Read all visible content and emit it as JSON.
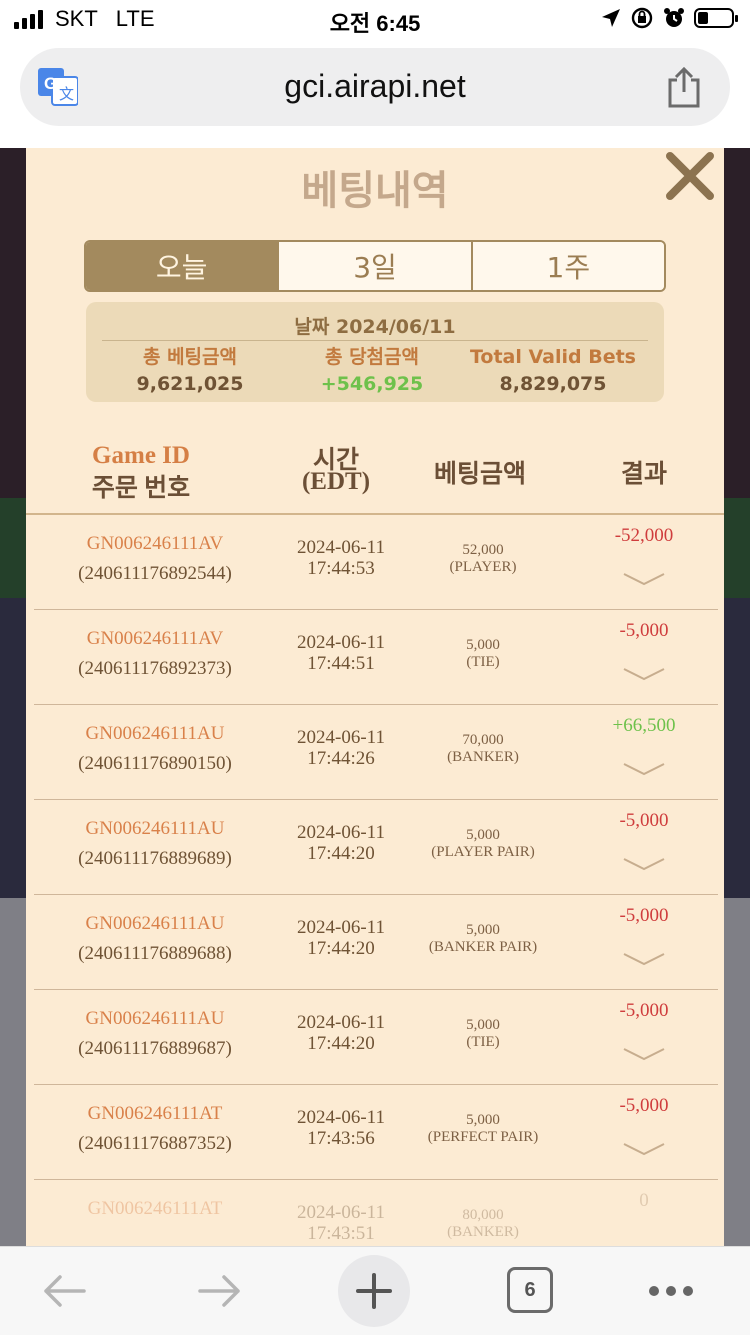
{
  "status_bar": {
    "carrier": "SKT",
    "network": "LTE",
    "time": "오전 6:45"
  },
  "browser": {
    "url": "gci.airapi.net",
    "tab_count": "6"
  },
  "modal": {
    "title": "베팅내역",
    "tabs": [
      {
        "label": "오늘",
        "active": true
      },
      {
        "label": "3일",
        "active": false
      },
      {
        "label": "1주",
        "active": false
      }
    ],
    "summary": {
      "date_label": "날짜",
      "date": "2024/06/11",
      "total_bet_label": "총 베팅금액",
      "total_bet": "9,621,025",
      "total_win_label": "총 당첨금액",
      "total_win": "+546,925",
      "valid_label": "Total Valid Bets",
      "valid": "8,829,075"
    },
    "columns": {
      "game_id": "Game ID",
      "order_no": "주문 번호",
      "time": "시간",
      "time_zone": "(EDT)",
      "amount": "베팅금액",
      "result": "결과"
    },
    "rows": [
      {
        "game_id": "GN006246111AV",
        "order": "(240611176892544)",
        "date": "2024-06-11",
        "time": "17:44:53",
        "amount": "52,000",
        "bet_type": "(PLAYER)",
        "result": "-52,000",
        "result_class": "neg"
      },
      {
        "game_id": "GN006246111AV",
        "order": "(240611176892373)",
        "date": "2024-06-11",
        "time": "17:44:51",
        "amount": "5,000",
        "bet_type": "(TIE)",
        "result": "-5,000",
        "result_class": "neg"
      },
      {
        "game_id": "GN006246111AU",
        "order": "(240611176890150)",
        "date": "2024-06-11",
        "time": "17:44:26",
        "amount": "70,000",
        "bet_type": "(BANKER)",
        "result": "+66,500",
        "result_class": "pos"
      },
      {
        "game_id": "GN006246111AU",
        "order": "(240611176889689)",
        "date": "2024-06-11",
        "time": "17:44:20",
        "amount": "5,000",
        "bet_type": "(PLAYER PAIR)",
        "result": "-5,000",
        "result_class": "neg"
      },
      {
        "game_id": "GN006246111AU",
        "order": "(240611176889688)",
        "date": "2024-06-11",
        "time": "17:44:20",
        "amount": "5,000",
        "bet_type": "(BANKER PAIR)",
        "result": "-5,000",
        "result_class": "neg"
      },
      {
        "game_id": "GN006246111AU",
        "order": "(240611176889687)",
        "date": "2024-06-11",
        "time": "17:44:20",
        "amount": "5,000",
        "bet_type": "(TIE)",
        "result": "-5,000",
        "result_class": "neg"
      },
      {
        "game_id": "GN006246111AT",
        "order": "(240611176887352)",
        "date": "2024-06-11",
        "time": "17:43:56",
        "amount": "5,000",
        "bet_type": "(PERFECT PAIR)",
        "result": "-5,000",
        "result_class": "neg"
      },
      {
        "game_id": "GN006246111AT",
        "order": "",
        "date": "2024-06-11",
        "time": "17:43:51",
        "amount": "80,000",
        "bet_type": "(BANKER)",
        "result": "0",
        "result_class": "zero"
      }
    ]
  },
  "colors": {
    "modal_bg": "#fcebd3",
    "accent_brown": "#a38a5e",
    "negative": "#cf3d3d",
    "positive": "#6ec14b",
    "game_id": "#d9814a"
  },
  "icons": [
    "google-translate-icon",
    "share-icon",
    "close-icon",
    "chevron-down-icon",
    "back-arrow-icon",
    "forward-arrow-icon",
    "plus-icon",
    "tabs-icon",
    "more-icon"
  ]
}
